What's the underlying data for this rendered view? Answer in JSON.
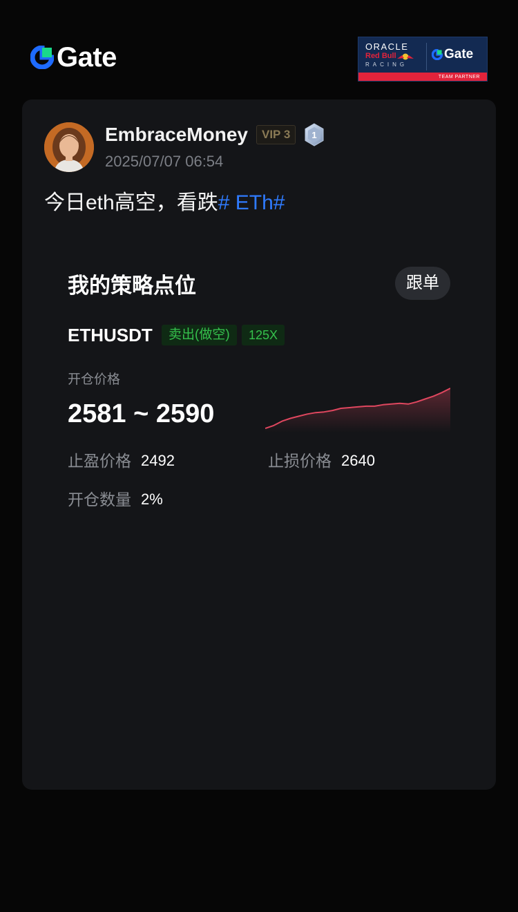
{
  "header": {
    "brand": "Gate",
    "partner": {
      "oracle": "ORACLE",
      "redbull": "Red Bull",
      "racing": "RACING",
      "brand": "Gate",
      "caption": "TEAM PARTNER"
    }
  },
  "post": {
    "username": "EmbraceMoney",
    "vip": "VIP 3",
    "level": "1",
    "timestamp": "2025/07/07 06:54",
    "text": "今日eth高空，看跌",
    "tag": "# ETh#"
  },
  "strategy": {
    "title": "我的策略点位",
    "follow_label": "跟单",
    "pair": "ETHUSDT",
    "side": "卖出(做空)",
    "leverage": "125X",
    "open_price_label": "开仓价格",
    "open_price_range": "2581 ~ 2590",
    "take_profit_label": "止盈价格",
    "take_profit_value": "2492",
    "stop_loss_label": "止损价格",
    "stop_loss_value": "2640",
    "open_qty_label": "开仓数量",
    "open_qty_value": "2%",
    "sparkline": [
      0,
      4,
      10,
      14,
      17,
      20,
      22,
      23,
      25,
      28,
      29,
      30,
      31,
      31,
      33,
      34,
      35,
      34,
      37,
      41,
      45,
      50,
      56
    ]
  },
  "colors": {
    "background": "#060606",
    "card": "#141518",
    "accent_blue": "#2f7bff",
    "short_green": "#35c14c",
    "sparkline_red": "#e0475f"
  }
}
